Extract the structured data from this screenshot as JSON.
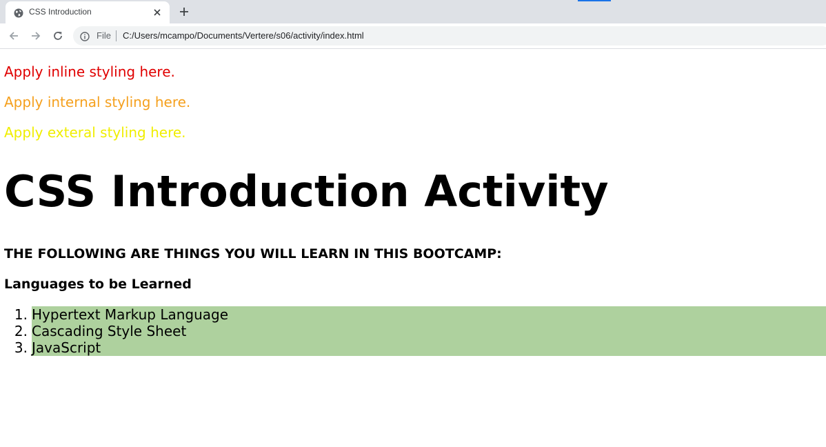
{
  "browser": {
    "tab": {
      "title": "CSS Introduction",
      "favicon": "globe-icon"
    },
    "new_tab_icon": "plus-icon",
    "nav": {
      "back_icon": "arrow-left-icon",
      "forward_icon": "arrow-right-icon",
      "reload_icon": "reload-icon"
    },
    "omnibox": {
      "info_icon": "info-icon",
      "scheme_label": "File",
      "url": "C:/Users/mcampo/Documents/Vertere/s06/activity/index.html"
    },
    "colors": {
      "tabstrip": "#dee1e6",
      "accent": "#1a73e8",
      "omnibox": "#f1f3f4"
    }
  },
  "page": {
    "lines": {
      "inline": {
        "text": "Apply inline styling here.",
        "color": "#e00000"
      },
      "internal": {
        "text": "Apply internal styling here.",
        "color": "#f5a01e"
      },
      "external": {
        "text": "Apply exteral styling here.",
        "color": "#f0ee00"
      }
    },
    "title": "CSS Introduction Activity",
    "subtitle": "THE FOLLOWING ARE THINGS YOU WILL LEARN IN THIS BOOTCAMP:",
    "list_heading": "Languages to be Learned",
    "languages": [
      {
        "num": "1.",
        "label": "Hypertext Markup Language"
      },
      {
        "num": "2.",
        "label": "Cascading Style Sheet"
      },
      {
        "num": "3.",
        "label": "JavaScript"
      }
    ],
    "list_background": "#aed19e"
  }
}
